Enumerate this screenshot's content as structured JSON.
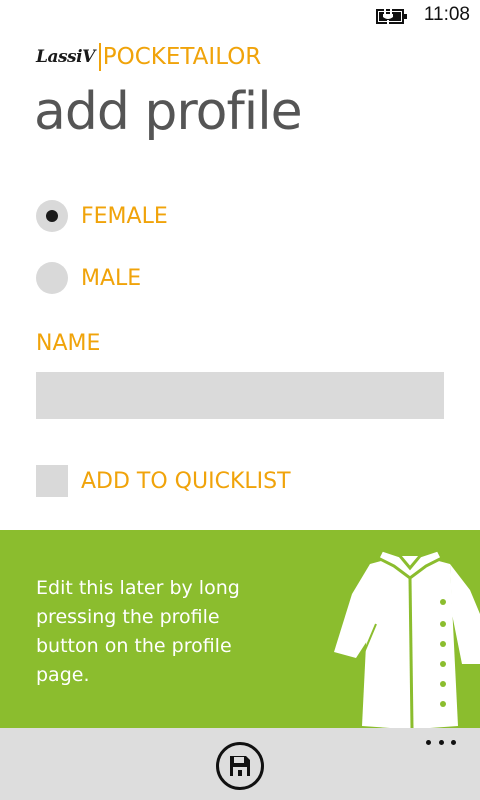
{
  "status_bar": {
    "time": "11:08",
    "battery_icon": "battery-charging-icon"
  },
  "header": {
    "brand_logo": "LassiV",
    "app_name": "POCKETAILOR",
    "page_title": "add profile"
  },
  "form": {
    "gender_options": [
      {
        "label": "FEMALE",
        "selected": true
      },
      {
        "label": "MALE",
        "selected": false
      }
    ],
    "name_label": "NAME",
    "name_value": "",
    "quicklist_label": "ADD TO QUICKLIST",
    "quicklist_checked": false
  },
  "info_panel": {
    "text": "Edit this later by long pressing the profile button on the profile page.",
    "illustration_icon": "shirt-icon"
  },
  "app_bar": {
    "save_icon": "save-icon",
    "more_icon": "more-ellipsis-icon"
  },
  "colors": {
    "accent": "#f0a30a",
    "panel_green": "#8bbd2e",
    "control_gray": "#d9d9d9",
    "app_bar_gray": "#dddddd"
  }
}
